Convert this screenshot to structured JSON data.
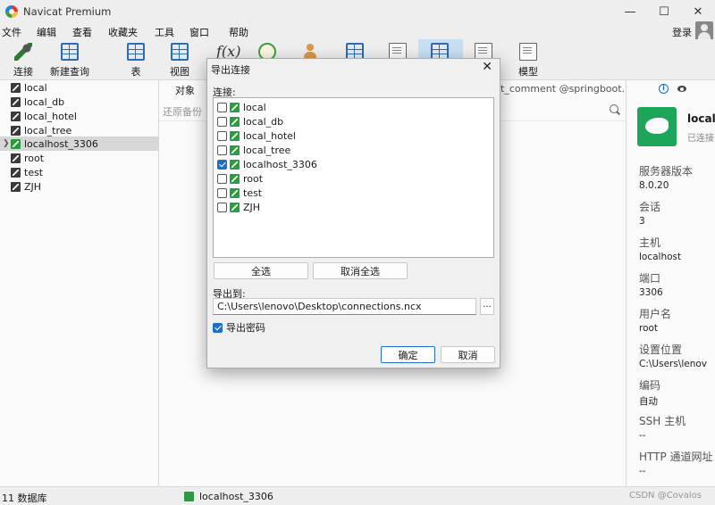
{
  "app": {
    "title": "Navicat Premium"
  },
  "menu": {
    "items": [
      "文件",
      "编辑",
      "查看",
      "收藏夹",
      "工具",
      "窗口",
      "帮助"
    ],
    "login": "登录"
  },
  "toolbar": {
    "connect": "连接",
    "new_query": "新建查询",
    "table": "表",
    "view": "视图",
    "model": "模型"
  },
  "sidebar": {
    "connections": [
      "local",
      "local_db",
      "local_hotel",
      "local_tree",
      "localhost_3306",
      "root",
      "test",
      "ZJH"
    ],
    "selected": "localhost_3306"
  },
  "center": {
    "objects_tab": "对象",
    "query_tab_title": "t_comment @springboot...",
    "restore_backup": "还原备份"
  },
  "info_panel": {
    "name": "local",
    "status": "已连接",
    "fields": [
      {
        "key": "服务器版本",
        "value": "8.0.20"
      },
      {
        "key": "会话",
        "value": "3"
      },
      {
        "key": "主机",
        "value": "localhost"
      },
      {
        "key": "端口",
        "value": "3306"
      },
      {
        "key": "用户名",
        "value": "root"
      },
      {
        "key": "设置位置",
        "value": "C:\\Users\\lenov"
      },
      {
        "key": "编码",
        "value": "自动"
      },
      {
        "key": "SSH 主机",
        "value": "--"
      },
      {
        "key": "HTTP 通道网址",
        "value": "--"
      }
    ]
  },
  "statusbar": {
    "count": "11 数据库",
    "connection": "localhost_3306",
    "watermark": "CSDN @Covalos"
  },
  "dialog": {
    "title": "导出连接",
    "connections_label": "连接:",
    "connections": [
      {
        "name": "local",
        "checked": false
      },
      {
        "name": "local_db",
        "checked": false
      },
      {
        "name": "local_hotel",
        "checked": false
      },
      {
        "name": "local_tree",
        "checked": false
      },
      {
        "name": "localhost_3306",
        "checked": true
      },
      {
        "name": "root",
        "checked": false
      },
      {
        "name": "test",
        "checked": false
      },
      {
        "name": "ZJH",
        "checked": false
      }
    ],
    "select_all": "全选",
    "deselect_all": "取消全选",
    "export_to_label": "导出到:",
    "export_path": "C:\\Users\\lenovo\\Desktop\\connections.ncx",
    "browse": "...",
    "export_password": "导出密码",
    "export_password_checked": true,
    "ok": "确定",
    "cancel": "取消"
  }
}
